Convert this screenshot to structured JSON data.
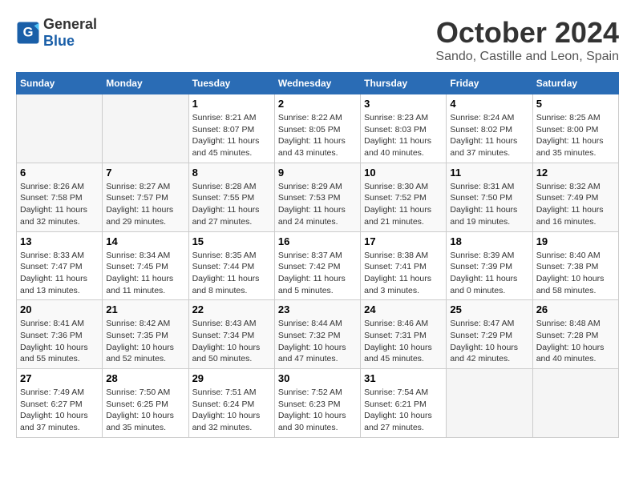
{
  "header": {
    "logo_general": "General",
    "logo_blue": "Blue",
    "month_title": "October 2024",
    "location": "Sando, Castille and Leon, Spain"
  },
  "weekdays": [
    "Sunday",
    "Monday",
    "Tuesday",
    "Wednesday",
    "Thursday",
    "Friday",
    "Saturday"
  ],
  "weeks": [
    [
      {
        "day": "",
        "info": ""
      },
      {
        "day": "",
        "info": ""
      },
      {
        "day": "1",
        "info": "Sunrise: 8:21 AM\nSunset: 8:07 PM\nDaylight: 11 hours and 45 minutes."
      },
      {
        "day": "2",
        "info": "Sunrise: 8:22 AM\nSunset: 8:05 PM\nDaylight: 11 hours and 43 minutes."
      },
      {
        "day": "3",
        "info": "Sunrise: 8:23 AM\nSunset: 8:03 PM\nDaylight: 11 hours and 40 minutes."
      },
      {
        "day": "4",
        "info": "Sunrise: 8:24 AM\nSunset: 8:02 PM\nDaylight: 11 hours and 37 minutes."
      },
      {
        "day": "5",
        "info": "Sunrise: 8:25 AM\nSunset: 8:00 PM\nDaylight: 11 hours and 35 minutes."
      }
    ],
    [
      {
        "day": "6",
        "info": "Sunrise: 8:26 AM\nSunset: 7:58 PM\nDaylight: 11 hours and 32 minutes."
      },
      {
        "day": "7",
        "info": "Sunrise: 8:27 AM\nSunset: 7:57 PM\nDaylight: 11 hours and 29 minutes."
      },
      {
        "day": "8",
        "info": "Sunrise: 8:28 AM\nSunset: 7:55 PM\nDaylight: 11 hours and 27 minutes."
      },
      {
        "day": "9",
        "info": "Sunrise: 8:29 AM\nSunset: 7:53 PM\nDaylight: 11 hours and 24 minutes."
      },
      {
        "day": "10",
        "info": "Sunrise: 8:30 AM\nSunset: 7:52 PM\nDaylight: 11 hours and 21 minutes."
      },
      {
        "day": "11",
        "info": "Sunrise: 8:31 AM\nSunset: 7:50 PM\nDaylight: 11 hours and 19 minutes."
      },
      {
        "day": "12",
        "info": "Sunrise: 8:32 AM\nSunset: 7:49 PM\nDaylight: 11 hours and 16 minutes."
      }
    ],
    [
      {
        "day": "13",
        "info": "Sunrise: 8:33 AM\nSunset: 7:47 PM\nDaylight: 11 hours and 13 minutes."
      },
      {
        "day": "14",
        "info": "Sunrise: 8:34 AM\nSunset: 7:45 PM\nDaylight: 11 hours and 11 minutes."
      },
      {
        "day": "15",
        "info": "Sunrise: 8:35 AM\nSunset: 7:44 PM\nDaylight: 11 hours and 8 minutes."
      },
      {
        "day": "16",
        "info": "Sunrise: 8:37 AM\nSunset: 7:42 PM\nDaylight: 11 hours and 5 minutes."
      },
      {
        "day": "17",
        "info": "Sunrise: 8:38 AM\nSunset: 7:41 PM\nDaylight: 11 hours and 3 minutes."
      },
      {
        "day": "18",
        "info": "Sunrise: 8:39 AM\nSunset: 7:39 PM\nDaylight: 11 hours and 0 minutes."
      },
      {
        "day": "19",
        "info": "Sunrise: 8:40 AM\nSunset: 7:38 PM\nDaylight: 10 hours and 58 minutes."
      }
    ],
    [
      {
        "day": "20",
        "info": "Sunrise: 8:41 AM\nSunset: 7:36 PM\nDaylight: 10 hours and 55 minutes."
      },
      {
        "day": "21",
        "info": "Sunrise: 8:42 AM\nSunset: 7:35 PM\nDaylight: 10 hours and 52 minutes."
      },
      {
        "day": "22",
        "info": "Sunrise: 8:43 AM\nSunset: 7:34 PM\nDaylight: 10 hours and 50 minutes."
      },
      {
        "day": "23",
        "info": "Sunrise: 8:44 AM\nSunset: 7:32 PM\nDaylight: 10 hours and 47 minutes."
      },
      {
        "day": "24",
        "info": "Sunrise: 8:46 AM\nSunset: 7:31 PM\nDaylight: 10 hours and 45 minutes."
      },
      {
        "day": "25",
        "info": "Sunrise: 8:47 AM\nSunset: 7:29 PM\nDaylight: 10 hours and 42 minutes."
      },
      {
        "day": "26",
        "info": "Sunrise: 8:48 AM\nSunset: 7:28 PM\nDaylight: 10 hours and 40 minutes."
      }
    ],
    [
      {
        "day": "27",
        "info": "Sunrise: 7:49 AM\nSunset: 6:27 PM\nDaylight: 10 hours and 37 minutes."
      },
      {
        "day": "28",
        "info": "Sunrise: 7:50 AM\nSunset: 6:25 PM\nDaylight: 10 hours and 35 minutes."
      },
      {
        "day": "29",
        "info": "Sunrise: 7:51 AM\nSunset: 6:24 PM\nDaylight: 10 hours and 32 minutes."
      },
      {
        "day": "30",
        "info": "Sunrise: 7:52 AM\nSunset: 6:23 PM\nDaylight: 10 hours and 30 minutes."
      },
      {
        "day": "31",
        "info": "Sunrise: 7:54 AM\nSunset: 6:21 PM\nDaylight: 10 hours and 27 minutes."
      },
      {
        "day": "",
        "info": ""
      },
      {
        "day": "",
        "info": ""
      }
    ]
  ]
}
